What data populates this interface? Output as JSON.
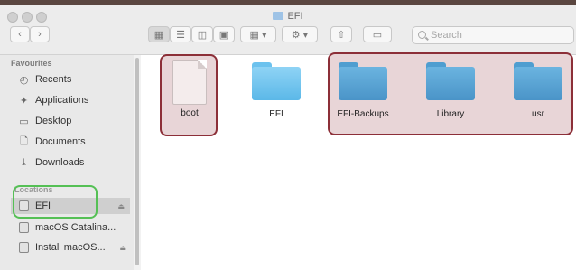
{
  "window": {
    "title": "EFI"
  },
  "toolbar": {
    "back_icon": "chevron-left-icon",
    "forward_icon": "chevron-right-icon",
    "view_icons": [
      "icon-view-icon",
      "list-view-icon",
      "column-view-icon",
      "gallery-view-icon"
    ],
    "group_icon": "group-by-icon",
    "action_icon": "gear-icon",
    "share_icon": "share-icon",
    "tag_icon": "tag-icon",
    "search_placeholder": "Search"
  },
  "sidebar": {
    "favourites_heading": "Favourites",
    "favourites": [
      {
        "label": "Recents",
        "icon": "clock-icon"
      },
      {
        "label": "Applications",
        "icon": "applications-icon"
      },
      {
        "label": "Desktop",
        "icon": "desktop-icon"
      },
      {
        "label": "Documents",
        "icon": "document-icon"
      },
      {
        "label": "Downloads",
        "icon": "download-icon"
      }
    ],
    "locations_heading": "Locations",
    "locations": [
      {
        "label": "EFI",
        "icon": "disk-icon",
        "eject": true,
        "selected": true
      },
      {
        "label": "macOS Catalina...",
        "icon": "disk-icon",
        "eject": false,
        "selected": false
      },
      {
        "label": "Install macOS...",
        "icon": "disk-icon",
        "eject": true,
        "selected": false
      }
    ]
  },
  "files": [
    {
      "name": "boot",
      "kind": "document",
      "icon": "document-file-icon",
      "highlighted": true
    },
    {
      "name": "EFI",
      "kind": "folder",
      "icon": "folder-icon",
      "highlighted": false
    },
    {
      "name": "EFI-Backups",
      "kind": "folder",
      "icon": "folder-icon",
      "highlighted": true
    },
    {
      "name": "Library",
      "kind": "folder",
      "icon": "folder-icon",
      "highlighted": true
    },
    {
      "name": "usr",
      "kind": "folder",
      "icon": "folder-icon",
      "highlighted": true
    }
  ],
  "annotations": {
    "red_highlight_color": "#8c2f38",
    "green_highlight_color": "#55c055"
  }
}
